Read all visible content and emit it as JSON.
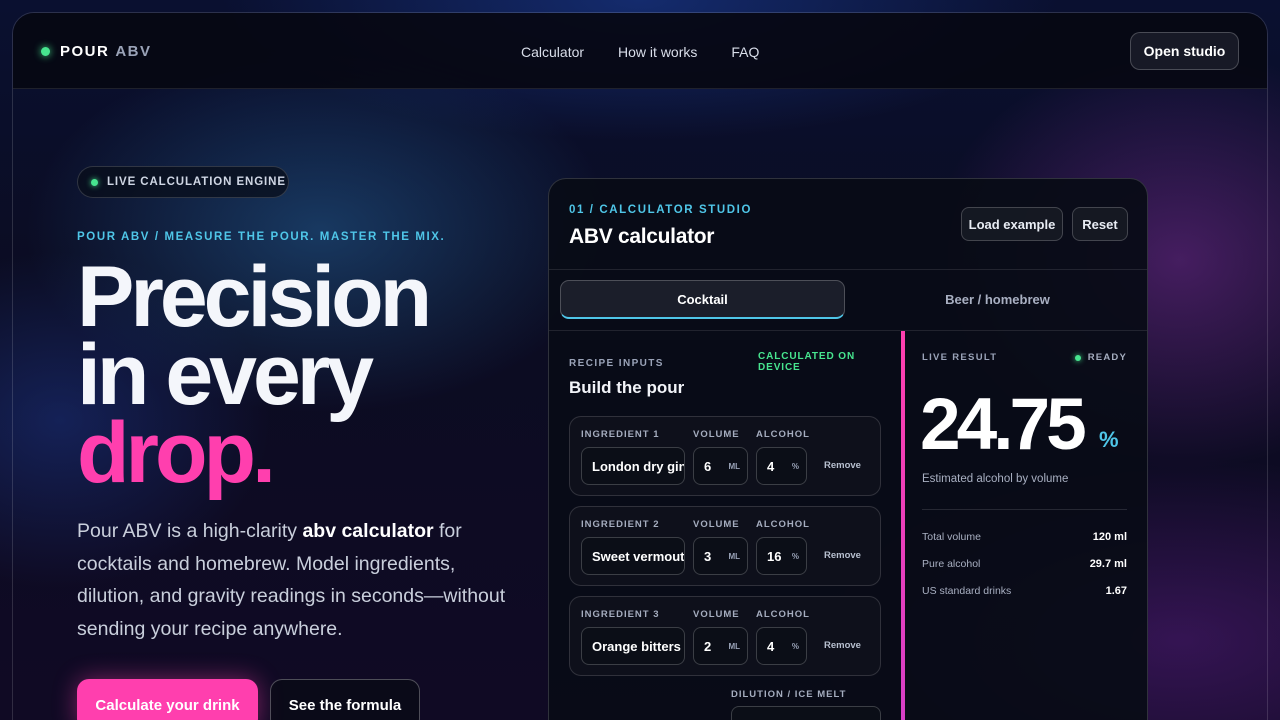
{
  "nav": {
    "brand_primary": "POUR",
    "brand_secondary": "ABV",
    "links": [
      "Calculator",
      "How it works",
      "FAQ"
    ],
    "cta": "Open studio"
  },
  "hero": {
    "pill": "LIVE CALCULATION ENGINE",
    "tagline": "POUR ABV / MEASURE THE POUR. MASTER THE MIX.",
    "headline_line1": "Precision",
    "headline_line2": "in every",
    "headline_line3": "drop.",
    "desc_before": "Pour ABV is a high-clarity ",
    "desc_bold": "abv calculator",
    "desc_after": " for cocktails and homebrew. Model ingredients, dilution, and gravity readings in seconds—without sending your recipe anywhere.",
    "primary_cta": "Calculate your drink",
    "secondary_cta": "See the formula"
  },
  "calculator": {
    "eyebrow": "01 / CALCULATOR STUDIO",
    "title": "ABV calculator",
    "load_example": "Load example",
    "reset": "Reset",
    "tabs": [
      "Cocktail",
      "Beer / homebrew"
    ],
    "recipe_label": "RECIPE INPUTS",
    "device_label": "CALCULATED ON DEVICE",
    "recipe_title": "Build the pour",
    "volume_label": "VOLUME",
    "alcohol_label": "ALCOHOL",
    "ml_unit": "ML",
    "pct_unit": "%",
    "remove_label": "Remove",
    "ingredients": [
      {
        "label": "INGREDIENT 1",
        "name": "London dry gin",
        "volume": "6",
        "alcohol": "4"
      },
      {
        "label": "INGREDIENT 2",
        "name": "Sweet vermouth",
        "volume": "3",
        "alcohol": "16"
      },
      {
        "label": "INGREDIENT 3",
        "name": "Orange bitters",
        "volume": "2",
        "alcohol": "4"
      }
    ],
    "dilution_label": "DILUTION / ICE MELT"
  },
  "result": {
    "label": "LIVE RESULT",
    "status": "READY",
    "value": "24.75",
    "unit": "%",
    "caption": "Estimated alcohol by volume",
    "stats": [
      {
        "key": "Total volume",
        "value": "120 ml"
      },
      {
        "key": "Pure alcohol",
        "value": "29.7 ml"
      },
      {
        "key": "US standard drinks",
        "value": "1.67"
      }
    ]
  },
  "colors": {
    "accent_pink": "#ff3fae",
    "accent_cyan": "#4fc6e8",
    "status_green": "#47e58f"
  }
}
